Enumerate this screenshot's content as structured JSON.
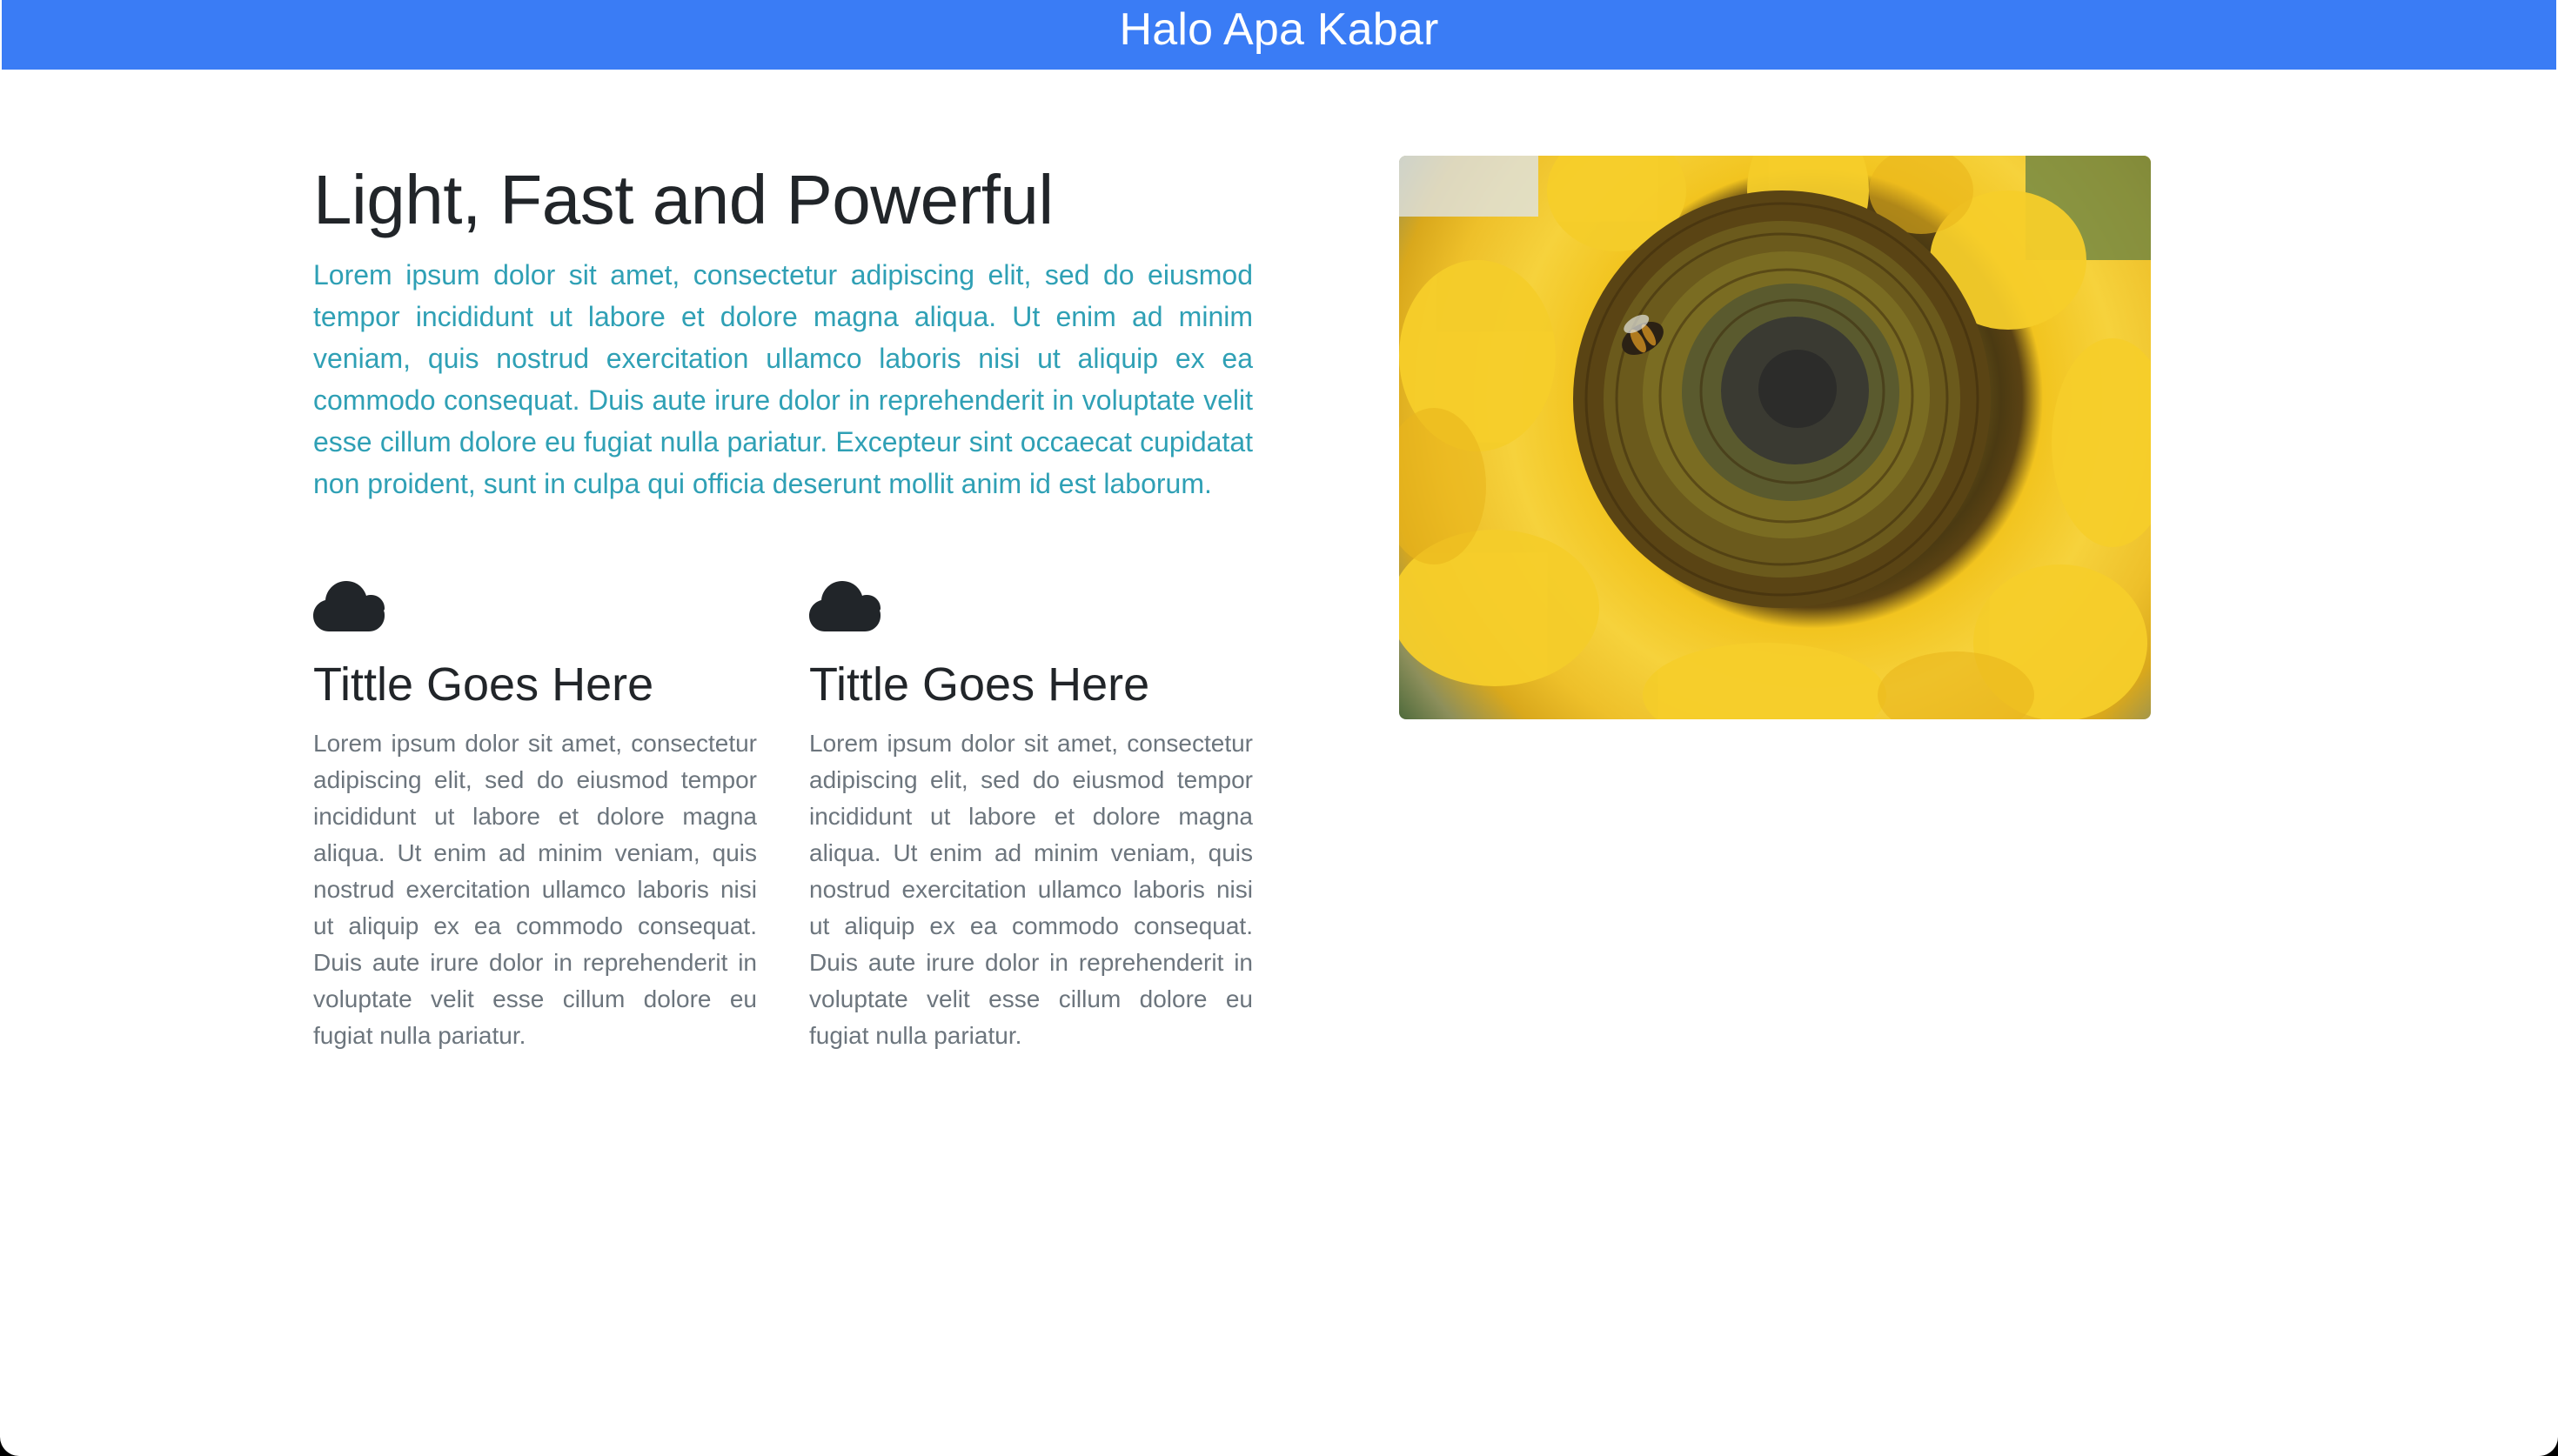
{
  "header": {
    "title": "Halo Apa Kabar"
  },
  "hero": {
    "headline": "Light, Fast and Powerful",
    "lead": "Lorem ipsum dolor sit amet, consectetur adipiscing elit, sed do eiusmod tempor incididunt ut labore et dolore magna aliqua. Ut enim ad minim veniam, quis nostrud exercitation ullamco laboris nisi ut aliquip ex ea commodo consequat. Duis aute irure dolor in reprehenderit in voluptate velit esse cillum dolore eu fugiat nulla pariatur. Excepteur sint occaecat cupidatat non proident, sunt in culpa qui officia deserunt mollit anim id est laborum."
  },
  "features": [
    {
      "icon": "cloud-icon",
      "title": "Tittle Goes Here",
      "text": "Lorem ipsum dolor sit amet, consectetur adipiscing elit, sed do eiusmod tempor incididunt ut labore et dolore magna aliqua. Ut enim ad minim veniam, quis nostrud exercitation ullamco laboris nisi ut aliquip ex ea commodo consequat. Duis aute irure dolor in reprehenderit in voluptate velit esse cillum dolore eu fugiat nulla pariatur."
    },
    {
      "icon": "cloud-icon",
      "title": "Tittle Goes Here",
      "text": "Lorem ipsum dolor sit amet, consectetur adipiscing elit, sed do eiusmod tempor incididunt ut labore et dolore magna aliqua. Ut enim ad minim veniam, quis nostrud exercitation ullamco laboris nisi ut aliquip ex ea commodo consequat. Duis aute irure dolor in reprehenderit in voluptate velit esse cillum dolore eu fugiat nulla pariatur."
    }
  ],
  "image": {
    "subject": "sunflower-with-bee-photo"
  },
  "colors": {
    "header_bg": "#3a7cf5",
    "lead_text": "#2fa0b5",
    "heading_text": "#212529",
    "body_text": "#6c757d"
  }
}
